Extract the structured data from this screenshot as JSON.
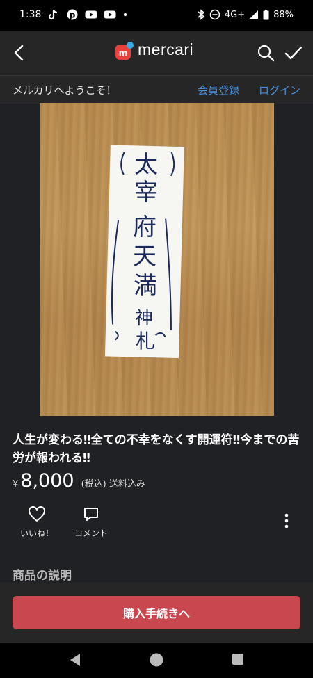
{
  "status_bar": {
    "time": "1:38",
    "network": "4G+",
    "battery": "88%",
    "app_icons": [
      "tiktok-icon",
      "pinterest-icon",
      "youtube-icon",
      "youtube-icon",
      "dot-icon"
    ],
    "system_icons": [
      "bluetooth-icon",
      "do-not-disturb-icon",
      "signal-icon",
      "battery-icon"
    ]
  },
  "header": {
    "logo_text": "mercari",
    "back_icon": "back-arrow-icon",
    "search_icon": "search-icon",
    "check_icon": "check-icon"
  },
  "welcome_bar": {
    "message": "メルカリへようこそ！",
    "register": "会員登録",
    "login": "ログイン"
  },
  "product": {
    "image_alt": "handwritten talisman paper on wood surface",
    "title": "人生が変わる‼全ての不幸をなくす開運符‼今までの苦労が報われる‼",
    "currency": "¥",
    "price": "8,000",
    "tax_note": "(税込) 送料込み",
    "talisman_text": [
      "太",
      "宰",
      "府",
      "天",
      "満",
      "神",
      "札"
    ]
  },
  "actions": {
    "like": "いいね！",
    "comment": "コメント",
    "more_icon": "more-vertical-icon"
  },
  "description": {
    "heading": "商品の説明"
  },
  "purchase": {
    "button": "購入手続きへ"
  },
  "colors": {
    "accent": "#c9474f",
    "link": "#4a90d9",
    "background": "#202124",
    "logo_red": "#e8413c",
    "logo_blue": "#3ea8e0"
  }
}
